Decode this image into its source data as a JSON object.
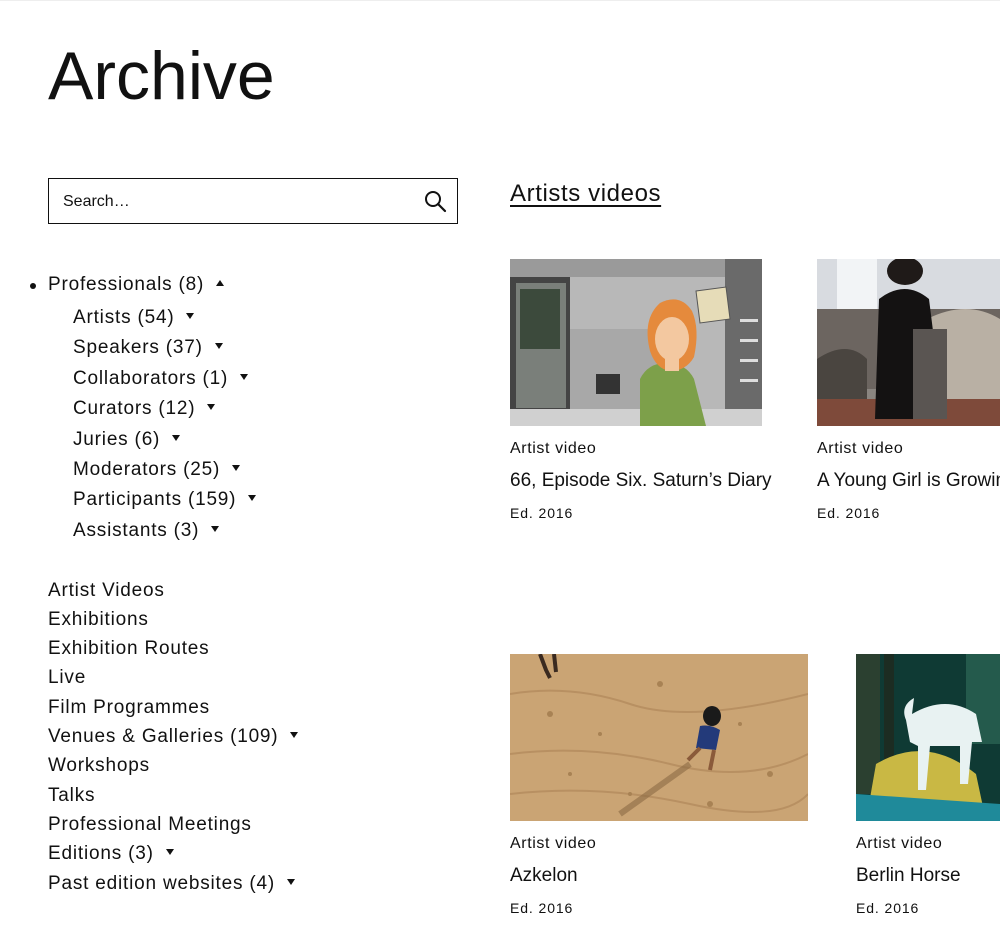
{
  "page": {
    "title": "Archive"
  },
  "search": {
    "placeholder": "Search…"
  },
  "sidebar": {
    "professionals": {
      "label": "Professionals (8)"
    },
    "sub_items": [
      {
        "label": "Artists (54)"
      },
      {
        "label": "Speakers (37)"
      },
      {
        "label": "Collaborators (1)"
      },
      {
        "label": "Curators (12)"
      },
      {
        "label": "Juries (6)"
      },
      {
        "label": "Moderators (25)"
      },
      {
        "label": "Participants (159)"
      },
      {
        "label": "Assistants (3)"
      }
    ],
    "items": [
      {
        "label": "Artist Videos"
      },
      {
        "label": "Exhibitions"
      },
      {
        "label": "Exhibition Routes"
      },
      {
        "label": "Live"
      },
      {
        "label": "Film Programmes"
      },
      {
        "label": "Venues & Galleries (109)"
      },
      {
        "label": "Workshops"
      },
      {
        "label": "Talks"
      },
      {
        "label": "Professional Meetings"
      },
      {
        "label": "Editions (3)"
      },
      {
        "label": "Past edition websites (4)"
      }
    ]
  },
  "main": {
    "section_title": "Artists videos",
    "cards": [
      {
        "kind": "Artist video",
        "title": "66, Episode Six. Saturn’s Diary",
        "edition": "Ed. 2016"
      },
      {
        "kind": "Artist video",
        "title": "A Young Girl is Growing",
        "edition": "Ed. 2016"
      },
      {
        "kind": "Artist video",
        "title": "Azkelon",
        "edition": "Ed. 2016"
      },
      {
        "kind": "Artist video",
        "title": "Berlin Horse",
        "edition": "Ed. 2016"
      }
    ]
  }
}
